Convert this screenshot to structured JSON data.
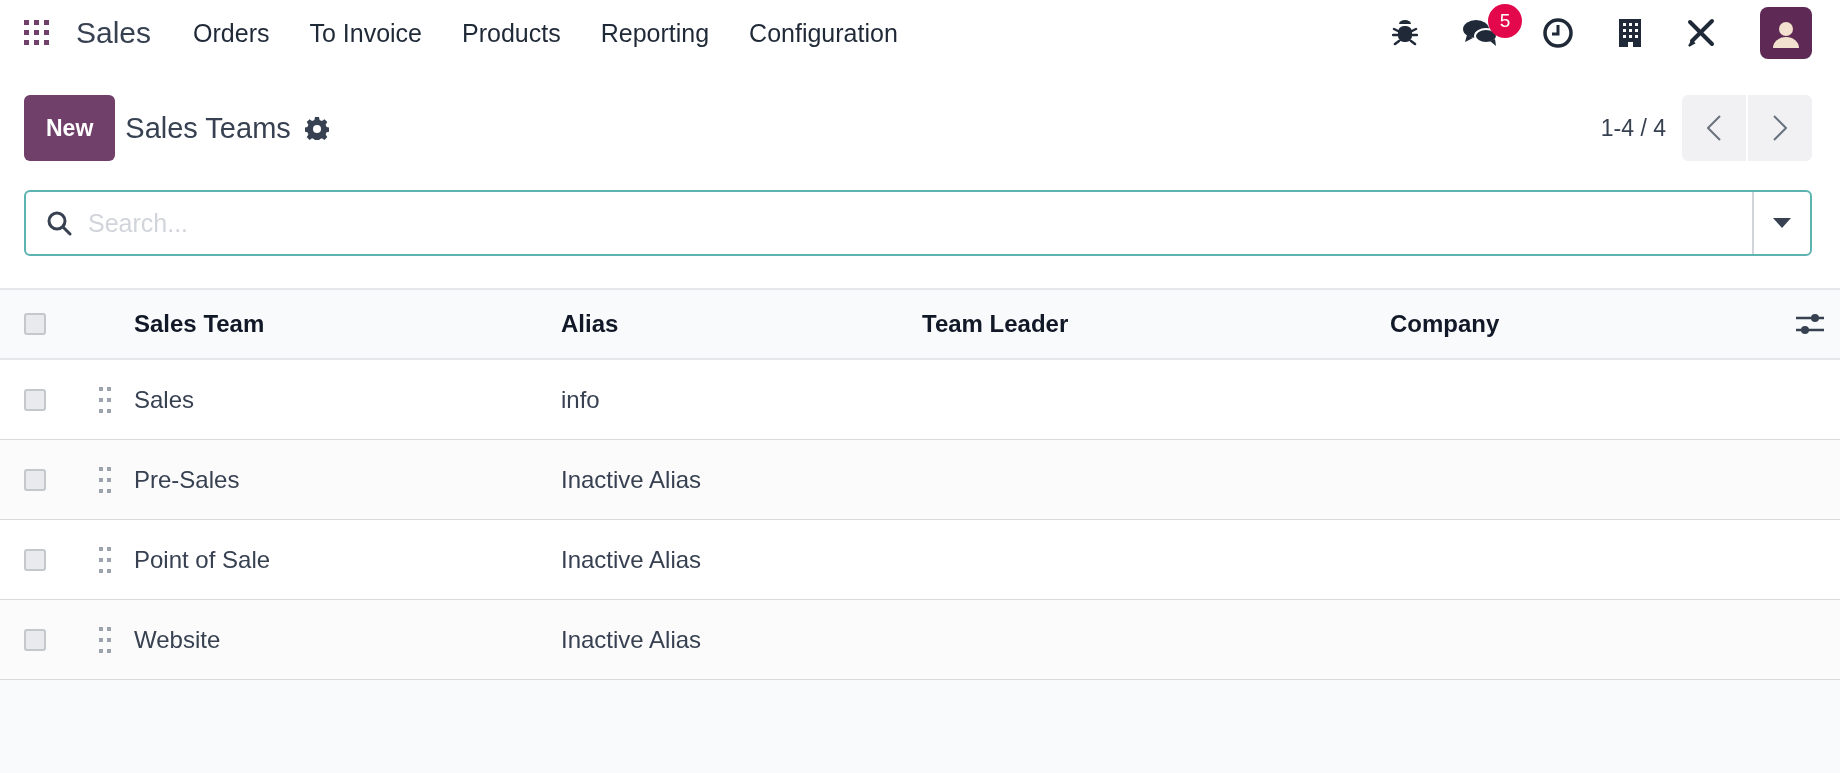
{
  "navbar": {
    "brand": "Sales",
    "menu": [
      "Orders",
      "To Invoice",
      "Products",
      "Reporting",
      "Configuration"
    ],
    "messages_badge": "5"
  },
  "control_panel": {
    "new_button": "New",
    "title": "Sales Teams",
    "pager": "1-4 / 4"
  },
  "search": {
    "placeholder": "Search..."
  },
  "table": {
    "columns": [
      "Sales Team",
      "Alias",
      "Team Leader",
      "Company"
    ],
    "header_checked": false,
    "rows": [
      {
        "checked": false,
        "cells": [
          "Sales",
          "info",
          "",
          ""
        ]
      },
      {
        "checked": false,
        "cells": [
          "Pre-Sales",
          "Inactive Alias",
          "",
          ""
        ]
      },
      {
        "checked": false,
        "cells": [
          "Point of Sale",
          "Inactive Alias",
          "",
          ""
        ]
      },
      {
        "checked": false,
        "cells": [
          "Website",
          "Inactive Alias",
          "",
          ""
        ]
      }
    ]
  }
}
